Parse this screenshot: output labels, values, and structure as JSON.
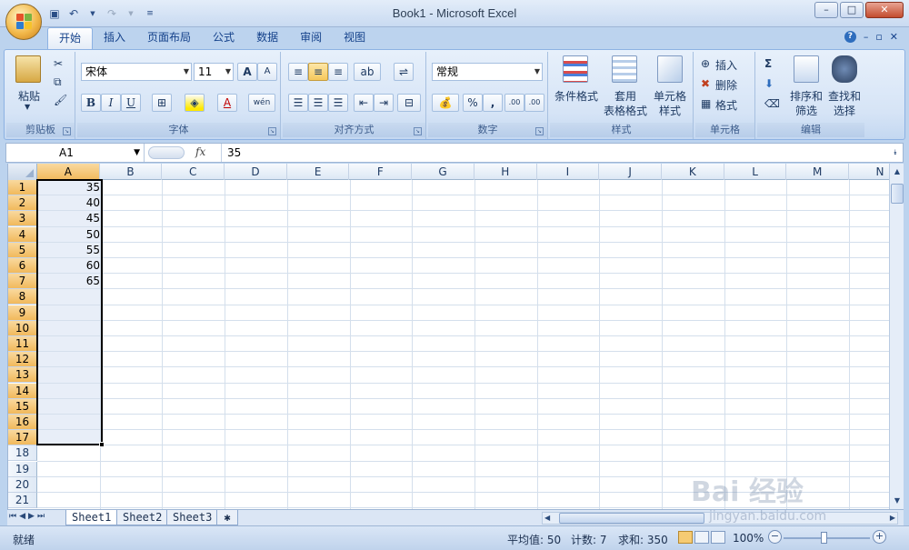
{
  "window": {
    "title": "Book1 - Microsoft Excel"
  },
  "tabs": [
    "开始",
    "插入",
    "页面布局",
    "公式",
    "数据",
    "审阅",
    "视图"
  ],
  "ribbon": {
    "clipboard": {
      "label": "剪贴板",
      "paste": "粘贴"
    },
    "font": {
      "label": "字体",
      "name": "宋体",
      "size": "11",
      "bold": "B",
      "italic": "I",
      "underline": "U",
      "grow": "A",
      "shrink": "A",
      "color_a": "A",
      "phonetic": "wén"
    },
    "alignment": {
      "label": "对齐方式"
    },
    "number": {
      "label": "数字",
      "format": "常规",
      "percent": "%",
      "comma": ",",
      "inc_dec": ".00",
      "dec_dec": ".00"
    },
    "styles": {
      "label": "样式",
      "cond": "条件格式",
      "table_1": "套用",
      "table_2": "表格格式",
      "cell_1": "单元格",
      "cell_2": "样式"
    },
    "cells": {
      "label": "单元格",
      "insert": "插入",
      "delete": "删除",
      "format": "格式"
    },
    "editing": {
      "label": "编辑",
      "sigma": "Σ",
      "sort_1": "排序和",
      "sort_2": "筛选",
      "find_1": "查找和",
      "find_2": "选择"
    }
  },
  "formula_bar": {
    "name_box": "A1",
    "fx": "fx",
    "content": "35"
  },
  "columns": [
    "A",
    "B",
    "C",
    "D",
    "E",
    "F",
    "G",
    "H",
    "I",
    "J",
    "K",
    "L",
    "M",
    "N"
  ],
  "rows": [
    "1",
    "2",
    "3",
    "4",
    "5",
    "6",
    "7",
    "8",
    "9",
    "10",
    "11",
    "12",
    "13",
    "14",
    "15",
    "16",
    "17",
    "18",
    "19",
    "20",
    "21"
  ],
  "cells": [
    "35",
    "40",
    "45",
    "50",
    "55",
    "60",
    "65"
  ],
  "sheets": [
    "Sheet1",
    "Sheet2",
    "Sheet3"
  ],
  "status": {
    "ready": "就绪",
    "average": "平均值: 50",
    "count": "计数: 7",
    "sum": "求和: 350",
    "zoom": "100%"
  },
  "watermark": {
    "logo": "Bai 经验",
    "url": "jingyan.baidu.com"
  },
  "colors": {
    "ribbon_bg": "#d6e4f6",
    "selected_header": "#f1b95c",
    "tab_text": "#15428b"
  }
}
